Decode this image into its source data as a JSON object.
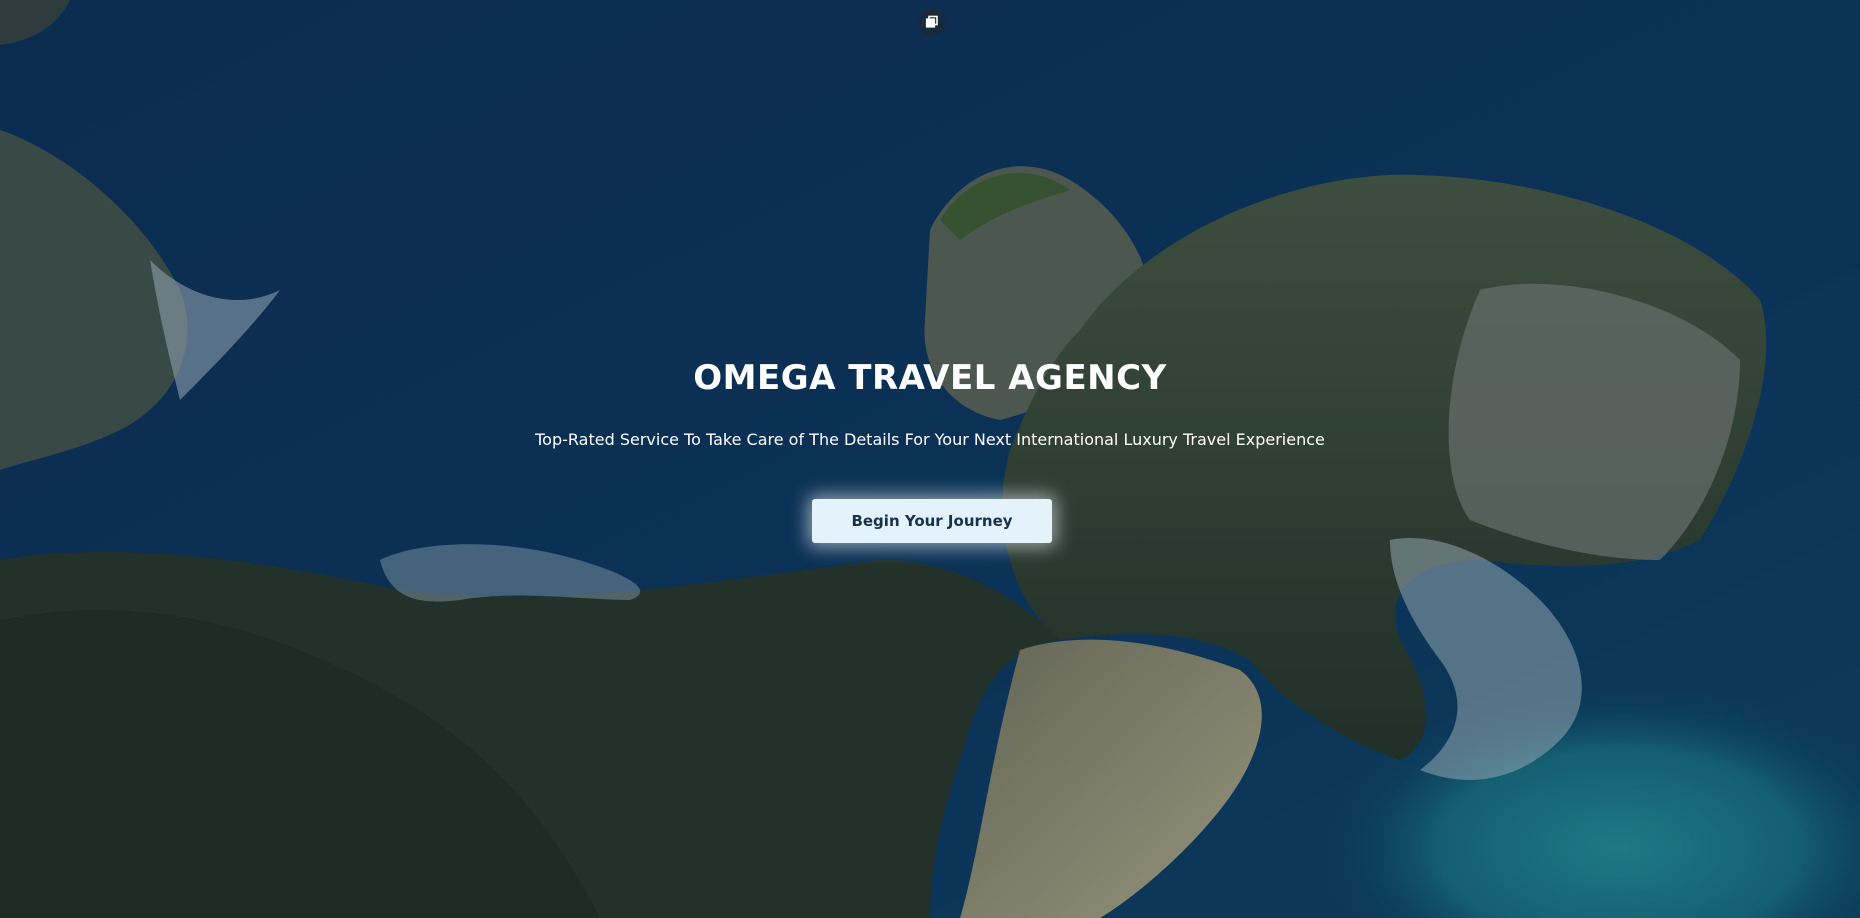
{
  "hero": {
    "title": "OMEGA TRAVEL AGENCY",
    "subtitle": "Top-Rated Service To Take Care of The Details For Your Next International Luxury Travel Experience",
    "cta_label": "Begin Your Journey",
    "background": "aerial-coastline-cliffs-photo"
  },
  "controls": {
    "toggle_icon": "restore-window-icon"
  },
  "colors": {
    "ocean_deep": "#0d3a63",
    "ocean_teal": "#1f8a9a",
    "cliff_green": "#3b5a2e",
    "sand": "#c9c095",
    "button_bg": "#e4f3fb",
    "button_text": "#17324a",
    "text": "#ffffff"
  }
}
